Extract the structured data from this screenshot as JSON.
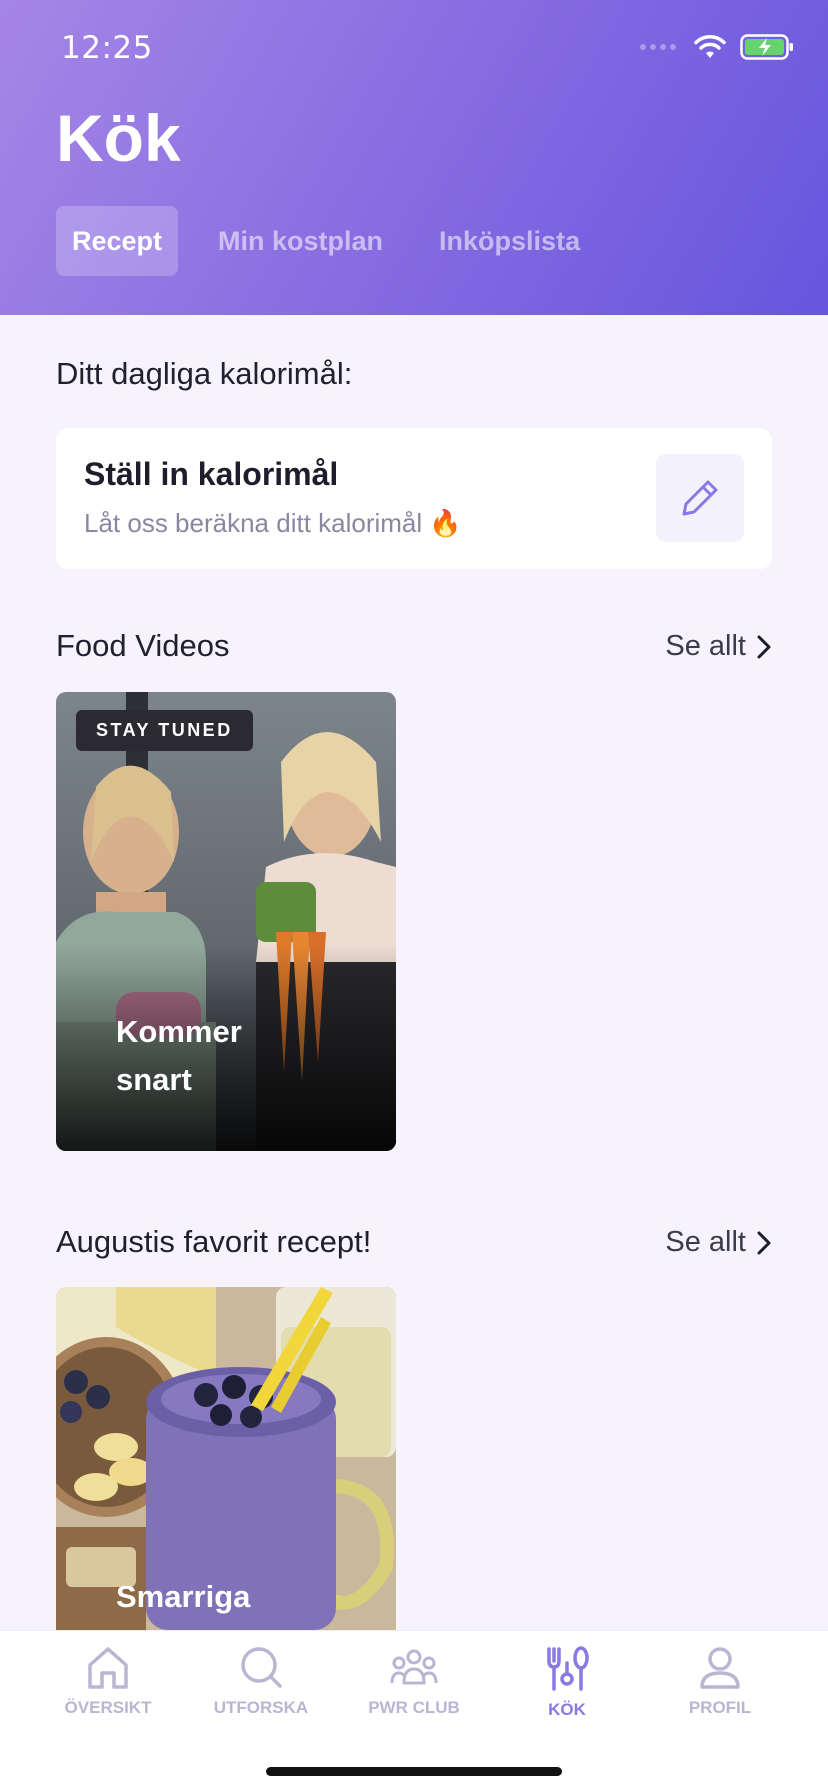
{
  "status_bar": {
    "time": "12:25"
  },
  "header": {
    "title": "Kök",
    "tabs": [
      {
        "label": "Recept",
        "active": true
      },
      {
        "label": "Min kostplan",
        "active": false
      },
      {
        "label": "Inköpslista",
        "active": false
      }
    ]
  },
  "calorie": {
    "section_label": "Ditt dagliga kalorimål:",
    "card_title": "Ställ in kalorimål",
    "card_subtitle": "Låt oss beräkna ditt kalorimål 🔥",
    "edit_icon": "pencil-icon"
  },
  "food_videos": {
    "title": "Food Videos",
    "see_all": "Se allt",
    "card": {
      "badge": "STAY TUNED",
      "caption_line1": "Kommer",
      "caption_line2": "snart"
    }
  },
  "favorites": {
    "title": "Augustis favorit recept!",
    "see_all": "Se allt",
    "card": {
      "caption": "Smarriga"
    }
  },
  "tabbar": {
    "items": [
      {
        "label": "ÖVERSIKT",
        "icon": "home-icon"
      },
      {
        "label": "UTFORSKA",
        "icon": "search-icon"
      },
      {
        "label": "PWR CLUB",
        "icon": "group-icon"
      },
      {
        "label": "KÖK",
        "icon": "kitchen-icon",
        "active": true
      },
      {
        "label": "PROFIL",
        "icon": "profile-icon"
      }
    ]
  },
  "colors": {
    "accent": "#8c78e3",
    "header_start": "#a586e6",
    "header_end": "#6755de",
    "background": "#f6f3fd"
  }
}
